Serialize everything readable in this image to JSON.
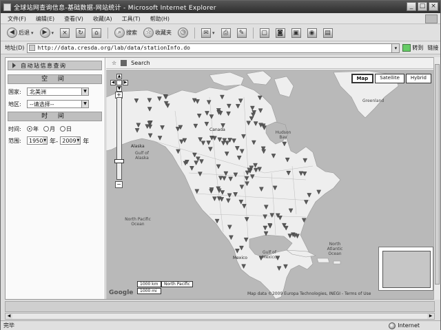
{
  "window": {
    "title": "全球站网查询信息-基础数据-网站统计 - Microsoft Internet Explorer"
  },
  "menu": [
    "文件(F)",
    "编辑(E)",
    "查看(V)",
    "收藏(A)",
    "工具(T)",
    "帮助(H)"
  ],
  "toolbar": {
    "back_label": "后退",
    "search_label": "搜索",
    "favorites_label": "收藏夹"
  },
  "address": {
    "label": "地址(D)",
    "url": "http://data.cresda.org/lab/data/stationInfo.do",
    "go_label": "转到",
    "links_label": "链接"
  },
  "left_panel": {
    "header": "自动站信息查询",
    "section_space": "空 间",
    "country_label": "国家:",
    "country_value": "北美洲",
    "region_label": "地区:",
    "region_value": "--请选择--",
    "section_time": "时 间",
    "period_label": "时间:",
    "period_options": [
      "年",
      "月",
      "日"
    ],
    "period_selected": 0,
    "range_label": "范围:",
    "year_from": "1950",
    "year_sep": "年-",
    "year_to": "2009",
    "year_suffix": "年"
  },
  "map": {
    "breadcrumb": "Search",
    "types": [
      "Map",
      "Satellite",
      "Hybrid"
    ],
    "active_type": "Map",
    "labels": {
      "canada": "Canada",
      "hudson": "Hudson Bay",
      "greenland": "Greenland",
      "alaska": "Alaska",
      "gulf_alaska": "Gulf of Alaska",
      "north_pacific": "North Pacific Ocean",
      "north_atlantic": "North Atlantic Ocean",
      "gulf_mexico": "Gulf of Mexico",
      "mexico": "Mexico"
    },
    "scale_top": "1000 km",
    "scale_bottom": "1000 mi",
    "scale_label": "North Pacific",
    "logo": "Google",
    "copyright": "Map data ©2009 Europa Technologies, INEGI - Terms of Use"
  },
  "status": {
    "text": "完毕",
    "zone": "Internet"
  },
  "colors": {
    "land": "#eeeeee",
    "ocean": "#b9b9b9",
    "marker": "#5a5a5a"
  }
}
